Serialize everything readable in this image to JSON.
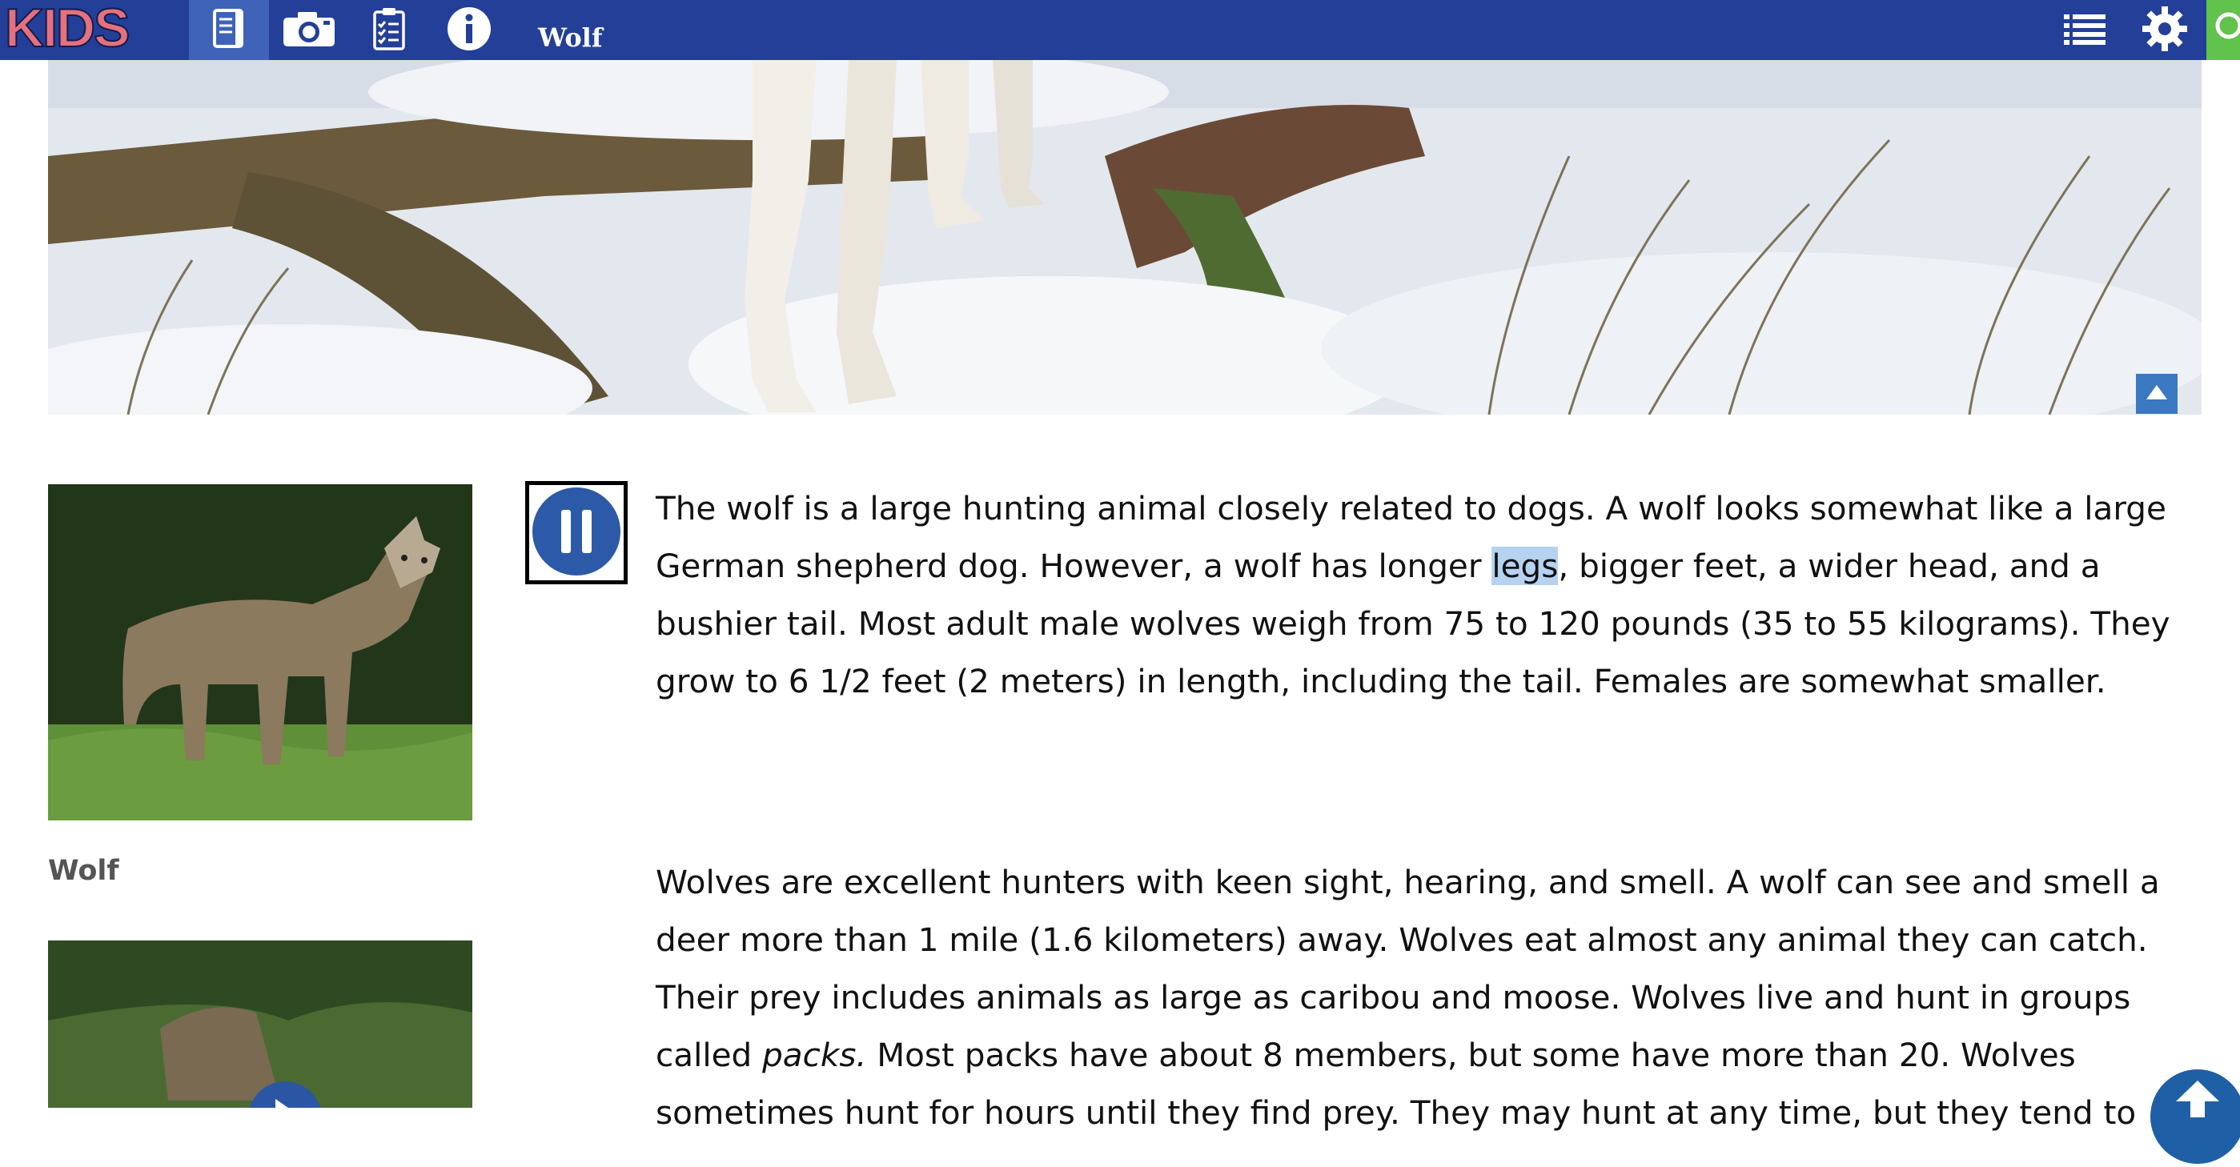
{
  "topbar": {
    "logo": "KIDS",
    "title": "Wolf",
    "buttons": [
      {
        "name": "article",
        "icon": "article-icon"
      },
      {
        "name": "media",
        "icon": "camera-icon"
      },
      {
        "name": "activities",
        "icon": "checklist-icon"
      },
      {
        "name": "info",
        "icon": "info-icon"
      }
    ],
    "right_icons": [
      "list-icon",
      "gear-icon",
      "search-icon"
    ]
  },
  "hero": {
    "alt_subject": "wolf legs in snow"
  },
  "sidebar": {
    "caption": "Wolf"
  },
  "audio": {
    "state": "pause"
  },
  "article": {
    "p1_a": "The wolf is a large hunting animal closely related to dogs. A wolf looks somewhat like a large German shepherd dog. However, a wolf has longer ",
    "p1_highlight": "legs",
    "p1_b": ", bigger feet, a wider head, and a bushier tail. Most adult male wolves weigh from 75 to 120 pounds (35 to 55 kilograms). They grow to 6 1/2 feet (2 meters) in length, including the tail. Females are somewhat smaller.",
    "p2_a": "Wolves are excellent hunters with keen sight, hearing, and smell. A wolf can see and smell a deer more than 1 mile (1.6 kilometers) away. Wolves eat almost any animal they can catch. Their prey includes animals as large as caribou and moose. Wolves live and hunt in groups called ",
    "p2_em": "packs.",
    "p2_b": " Most packs have about 8 members, but some have more than 20. Wolves sometimes hunt for hours until they find prey. They may hunt at any time, but they tend to"
  },
  "colors": {
    "topbar": "#233f98",
    "active_tab": "#3e63b8",
    "logo": "#e6707d",
    "highlight": "#b5d3f1",
    "accent_green": "#61c24c"
  }
}
